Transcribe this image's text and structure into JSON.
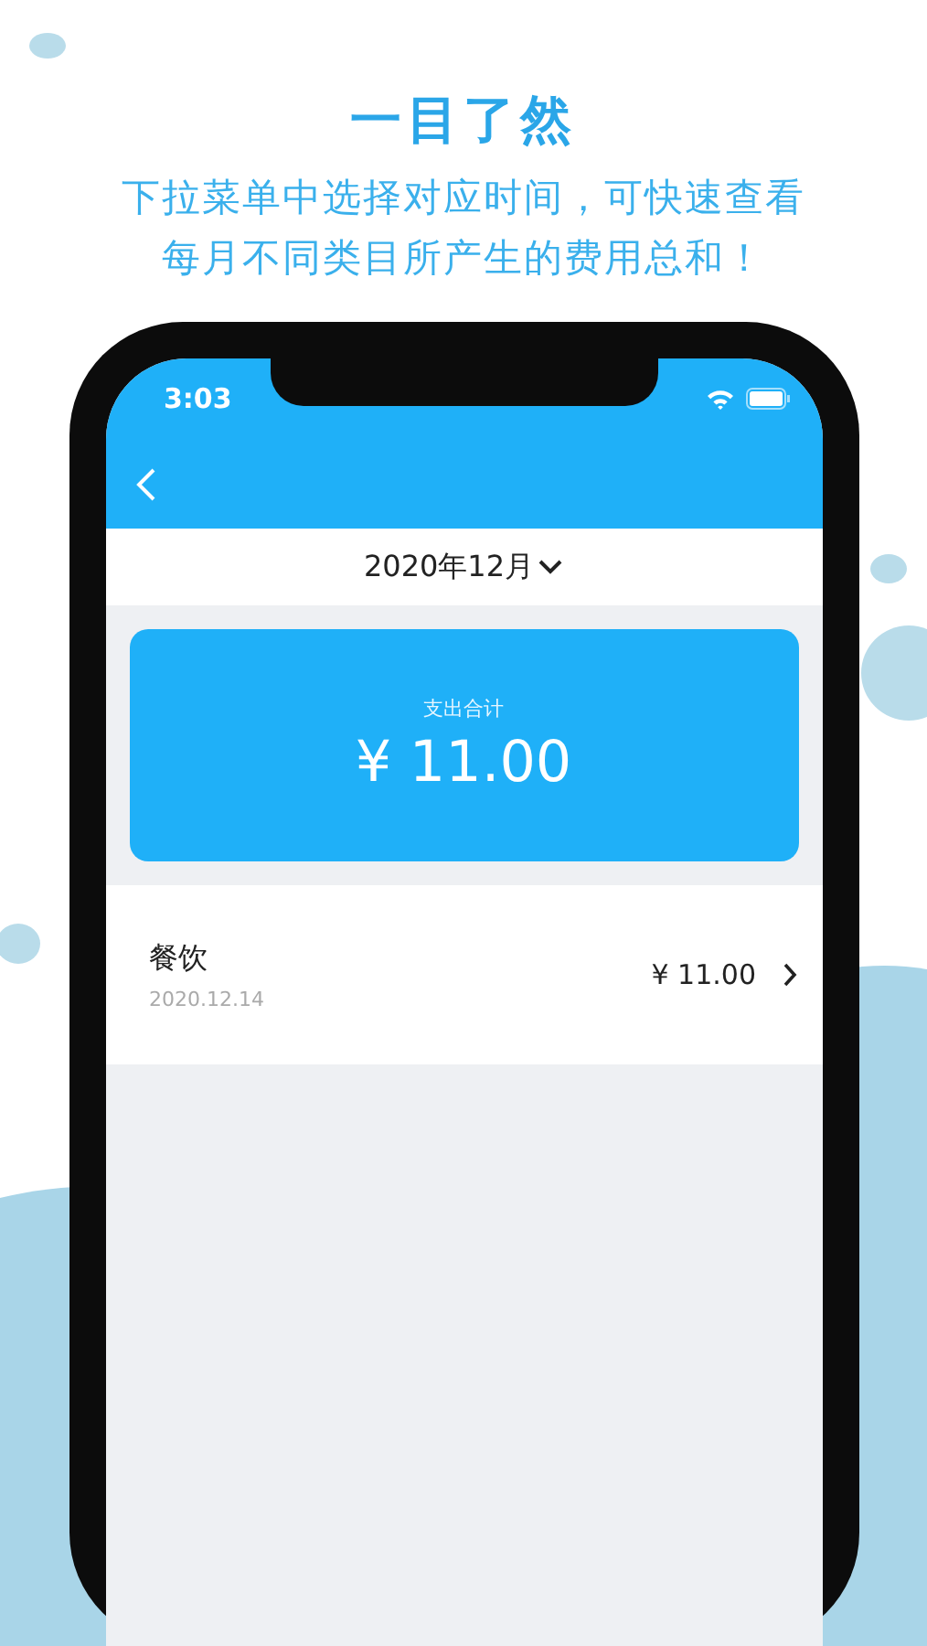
{
  "headline": "一目了然",
  "subtitle_lines": [
    "下拉菜单中选择对应时间，可快速查看",
    "每月不同类目所产生的费用总和！"
  ],
  "status_bar": {
    "time": "3:03"
  },
  "month_picker": {
    "label": "2020年12月"
  },
  "summary": {
    "label": "支出合计",
    "amount": "¥ 11.00"
  },
  "expenses": [
    {
      "category": "餐饮",
      "date": "2020.12.14",
      "amount": "¥ 11.00"
    }
  ]
}
